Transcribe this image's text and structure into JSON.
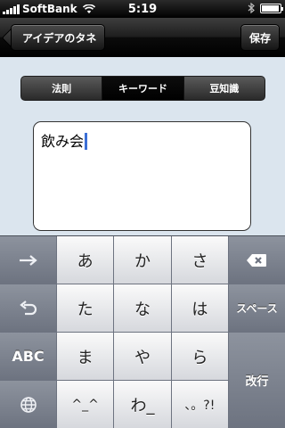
{
  "status_bar": {
    "carrier": "SoftBank",
    "time": "5:19",
    "icons": [
      "signal-bars-icon",
      "wifi-icon",
      "bluetooth-icon",
      "battery-icon"
    ]
  },
  "nav": {
    "back_label": "アイデアのタネ",
    "save_label": "保存"
  },
  "segments": {
    "items": [
      "法則",
      "キーワード",
      "豆知識"
    ],
    "selected": "キーワード"
  },
  "text_view": {
    "value": "飲み会"
  },
  "keyboard": {
    "rows": [
      [
        "→",
        "あ",
        "か",
        "さ",
        "delete-icon"
      ],
      [
        "undo-icon",
        "た",
        "な",
        "は",
        "スペース"
      ],
      [
        "ABC",
        "ま",
        "や",
        "ら",
        "改行"
      ],
      [
        "globe-icon",
        "^_^",
        "わ_",
        "、。?!"
      ]
    ],
    "keys": {
      "next": "→",
      "a": "あ",
      "ka": "か",
      "sa": "さ",
      "ta": "た",
      "na": "な",
      "ha": "は",
      "abc": "ABC",
      "ma": "ま",
      "ya": "や",
      "ra": "ら",
      "emoticon": "^_^",
      "wa": "わ_",
      "punct": "、。?!",
      "space": "スペース",
      "return": "改行"
    }
  },
  "colors": {
    "accent_cursor": "#3b6fd6",
    "background": "#dbe5ee",
    "keyboard_bg": "#6d7380"
  }
}
